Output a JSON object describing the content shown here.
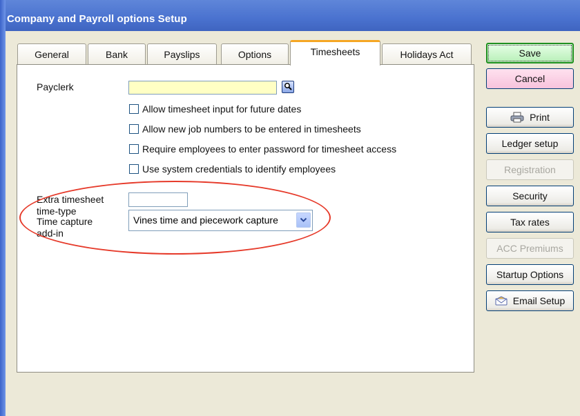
{
  "window": {
    "title": "Company and Payroll options Setup"
  },
  "tabs": [
    {
      "label": "General",
      "active": false
    },
    {
      "label": "Bank",
      "active": false
    },
    {
      "label": "Payslips",
      "active": false
    },
    {
      "label": "Options",
      "active": false
    },
    {
      "label": "Timesheets",
      "active": true
    },
    {
      "label": "Holidays Act",
      "active": false
    }
  ],
  "form": {
    "payclerk_label": "Payclerk",
    "payclerk_value": "",
    "checkboxes": [
      {
        "label": "Allow timesheet input for future dates",
        "checked": false
      },
      {
        "label": "Allow new job numbers to be entered in timesheets",
        "checked": false
      },
      {
        "label": "Require employees to enter password for timesheet access",
        "checked": false
      },
      {
        "label": "Use system credentials to identify employees",
        "checked": false
      }
    ],
    "extra_label_1": "Extra timesheet",
    "extra_label_2": "time-type",
    "extra_value": "",
    "capture_label_1": "Time capture",
    "capture_label_2": "add-in",
    "capture_value": "Vines time and piecework capture"
  },
  "buttons": {
    "save": "Save",
    "cancel": "Cancel",
    "print": "Print",
    "ledger": "Ledger setup",
    "registration": "Registration",
    "security": "Security",
    "taxrates": "Tax rates",
    "acc": "ACC Premiums",
    "startup": "Startup Options",
    "email": "Email Setup"
  },
  "colors": {
    "title_bar": "#4a72cf",
    "active_tab_accent": "#f5a623",
    "annotation": "#e63a2a",
    "payclerk_field": "#ffffc4"
  }
}
